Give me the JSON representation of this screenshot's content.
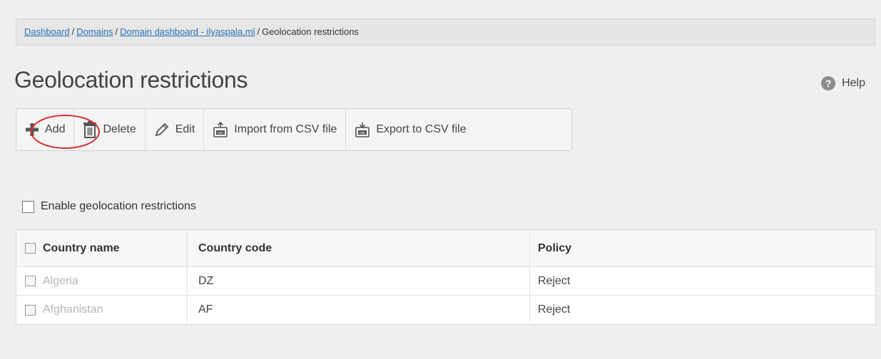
{
  "breadcrumb": {
    "items": [
      "Dashboard",
      "Domains",
      "Domain dashboard - ilyaspala.ml"
    ],
    "current": "Geolocation restrictions",
    "separator": "/"
  },
  "page": {
    "title": "Geolocation restrictions",
    "help_label": "Help",
    "help_glyph": "?"
  },
  "toolbar": {
    "add_label": "Add",
    "delete_label": "Delete",
    "edit_label": "Edit",
    "import_label": "Import from CSV file",
    "export_label": "Export to CSV file"
  },
  "enable": {
    "label": "Enable geolocation restrictions",
    "checked": false
  },
  "table": {
    "columns": [
      "Country name",
      "Country code",
      "Policy"
    ],
    "rows": [
      {
        "country_name": "Algeria",
        "country_code": "DZ",
        "policy": "Reject"
      },
      {
        "country_name": "Afghanistan",
        "country_code": "AF",
        "policy": "Reject"
      }
    ]
  },
  "colors": {
    "link": "#2a6fb8",
    "highlight_circle": "#d72b2b",
    "background": "#efefef"
  }
}
